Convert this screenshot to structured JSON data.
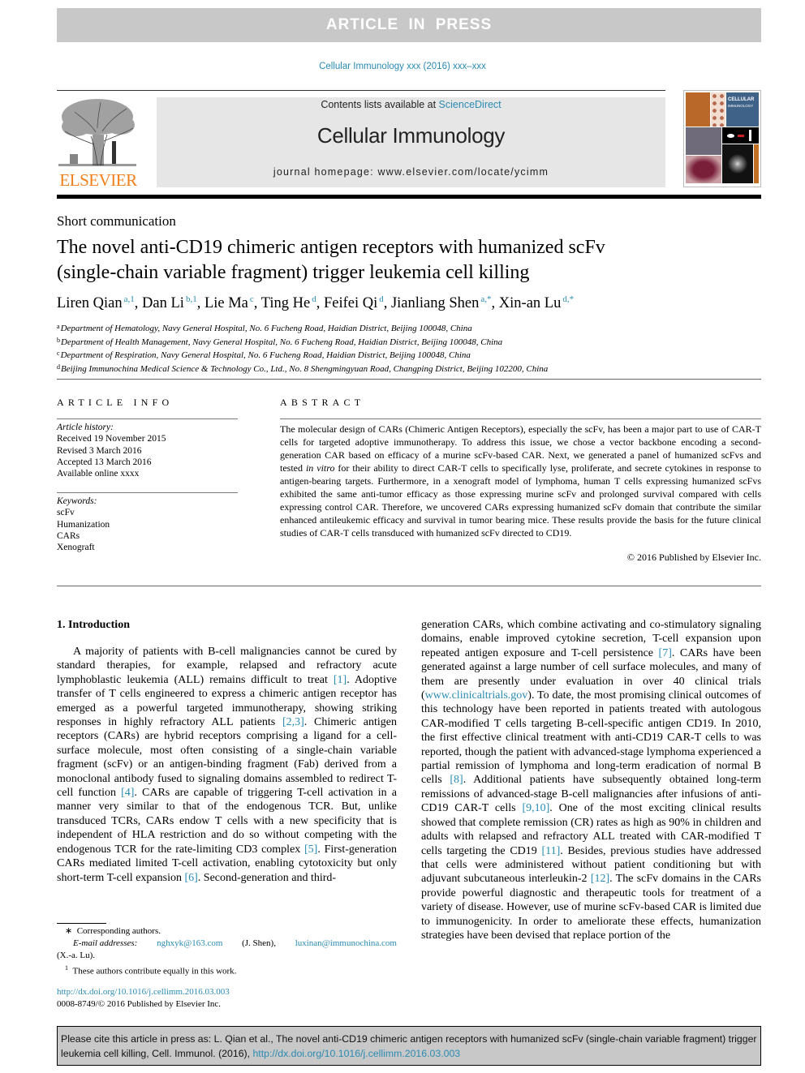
{
  "banner": {
    "text": "ARTICLE IN PRESS"
  },
  "journal_ref": "Cellular Immunology xxx (2016) xxx–xxx",
  "masthead": {
    "publisher_logo_text": "ELSEVIER",
    "contents_prefix": "Contents lists available at ",
    "contents_link": "ScienceDirect",
    "journal_title": "Cellular Immunology",
    "homepage_prefix": "journal homepage: ",
    "homepage_url": "www.elsevier.com/locate/ycimm",
    "cover_title_line1": "CELLULAR",
    "cover_title_line2": "IMMUNOLOGY"
  },
  "colors": {
    "link": "#2a8bb3",
    "elsevier_orange": "#f07f1b",
    "banner_gray": "#c8c8c8",
    "masthead_gray": "#e6e6e6"
  },
  "article": {
    "type": "Short communication",
    "title_line1": "The novel anti-CD19 chimeric antigen receptors with humanized scFv",
    "title_line2": "(single-chain variable fragment) trigger leukemia cell killing",
    "authors": [
      {
        "name": "Liren Qian",
        "sup": "a,1",
        "sep": ", "
      },
      {
        "name": "Dan Li",
        "sup": "b,1",
        "sep": ", "
      },
      {
        "name": "Lie Ma",
        "sup": "c",
        "sep": ", "
      },
      {
        "name": "Ting He",
        "sup": "d",
        "sep": ", "
      },
      {
        "name": "Feifei Qi",
        "sup": "d",
        "sep": ", "
      },
      {
        "name": "Jianliang Shen",
        "sup": "a,*",
        "sep": ", "
      },
      {
        "name": "Xin-an Lu",
        "sup": "d,*",
        "sep": ""
      }
    ],
    "affiliations": [
      {
        "key": "a",
        "text": "Department of Hematology, Navy General Hospital, No. 6 Fucheng Road, Haidian District, Beijing 100048, China"
      },
      {
        "key": "b",
        "text": "Department of Health Management, Navy General Hospital, No. 6 Fucheng Road, Haidian District, Beijing 100048, China"
      },
      {
        "key": "c",
        "text": "Department of Respiration, Navy General Hospital, No. 6 Fucheng Road, Haidian District, Beijing 100048, China"
      },
      {
        "key": "d",
        "text": "Beijing Immunochina Medical Science & Technology Co., Ltd., No. 8 Shengmingyuan Road, Changping District, Beijing 102200, China"
      }
    ]
  },
  "article_info": {
    "heading": "ARTICLE INFO",
    "history_label": "Article history:",
    "history": [
      "Received 19 November 2015",
      "Revised 3 March 2016",
      "Accepted 13 March 2016",
      "Available online xxxx"
    ],
    "keywords_label": "Keywords:",
    "keywords": [
      "scFv",
      "Humanization",
      "CARs",
      "Xenograft"
    ]
  },
  "abstract": {
    "heading": "ABSTRACT",
    "part1": "The molecular design of CARs (Chimeric Antigen Receptors), especially the scFv, has been a major part to use of CAR-T cells for targeted adoptive immunotherapy. To address this issue, we chose a vector backbone encoding a second-generation CAR based on efficacy of a murine scFv-based CAR. Next, we generated a panel of humanized scFvs and tested ",
    "italic": "in vitro",
    "part2": " for their ability to direct CAR-T cells to specifically lyse, proliferate, and secrete cytokines in response to antigen-bearing targets. Furthermore, in a xenograft model of lymphoma, human T cells expressing humanized scFvs exhibited the same anti-tumor efficacy as those expressing murine scFv and prolonged survival compared with cells expressing control CAR. Therefore, we uncovered CARs expressing humanized scFv domain that contribute the similar enhanced antileukemic efficacy and survival in tumor bearing mice. These results provide the basis for the future clinical studies of CAR-T cells transduced with humanized scFv directed to CD19.",
    "copyright": "© 2016 Published by Elsevier Inc."
  },
  "introduction": {
    "heading": "1. Introduction",
    "left_segments": [
      {
        "t": "A majority of patients with B-cell malignancies cannot be cured by standard therapies, for example, relapsed and refractory acute lymphoblastic leukemia (ALL) remains difficult to treat "
      },
      {
        "ref": "[1]"
      },
      {
        "t": ". Adoptive transfer of T cells engineered to express a chimeric antigen receptor has emerged as a powerful targeted immunotherapy, showing striking responses in highly refractory ALL patients "
      },
      {
        "ref": "[2,3]"
      },
      {
        "t": ". Chimeric antigen receptors (CARs) are hybrid receptors comprising a ligand for a cell-surface molecule, most often consisting of a single-chain variable fragment (scFv) or an antigen-binding fragment (Fab) derived from a monoclonal antibody fused to signaling domains assembled to redirect T-cell function "
      },
      {
        "ref": "[4]"
      },
      {
        "t": ". CARs are capable of triggering T-cell activation in a manner very similar to that of the endogenous TCR. But, unlike transduced TCRs, CARs endow T cells with a new specificity that is independent of HLA restriction and do so without competing with the endogenous TCR for the rate-limiting CD3 complex "
      },
      {
        "ref": "[5]"
      },
      {
        "t": ". First-generation CARs mediated limited T-cell activation, enabling cytotoxicity but only short-term T-cell expansion "
      },
      {
        "ref": "[6]"
      },
      {
        "t": ". Second-generation and third-"
      }
    ],
    "right_segments": [
      {
        "t": "generation CARs, which combine activating and co-stimulatory signaling domains, enable improved cytokine secretion, T-cell expansion upon repeated antigen exposure and T-cell persistence "
      },
      {
        "ref": "[7]"
      },
      {
        "t": ". CARs have been generated against a large number of cell surface molecules, and many of them are presently under evaluation in over 40 clinical trials ("
      },
      {
        "ref": "www.clinicaltrials.gov"
      },
      {
        "t": "). To date, the most promising clinical outcomes of this technology have been reported in patients treated with autologous CAR-modified T cells targeting B-cell-specific antigen CD19. In 2010, the first effective clinical treatment with anti-CD19 CAR-T cells to was reported, though the patient with advanced-stage lymphoma experienced a partial remission of lymphoma and long-term eradication of normal B cells "
      },
      {
        "ref": "[8]"
      },
      {
        "t": ". Additional patients have subsequently obtained long-term remissions of advanced-stage B-cell malignancies after infusions of anti-CD19 CAR-T cells "
      },
      {
        "ref": "[9,10]"
      },
      {
        "t": ". One of the most exciting clinical results showed that complete remission (CR) rates as high as 90% in children and adults with relapsed and refractory ALL treated with CAR-modified T cells targeting the CD19 "
      },
      {
        "ref": "[11]"
      },
      {
        "t": ". Besides, previous studies have addressed that cells were administered without patient conditioning but with adjuvant subcutaneous interleukin-2 "
      },
      {
        "ref": "[12]"
      },
      {
        "t": ". The scFv domains in the CARs provide powerful diagnostic and therapeutic tools for treatment of a variety of disease. However, use of murine scFv-based CAR is limited due to immunogenicity. In order to ameliorate these effects, humanization strategies have been devised that replace portion of the"
      }
    ]
  },
  "footnotes": {
    "corresponding": "Corresponding authors.",
    "email_label": "E-mail addresses:",
    "email1": "nghxyk@163.com",
    "email1_who": "(J. Shen),",
    "email2": "luxinan@immunochina.com",
    "email2_who": "(X.-a. Lu).",
    "equal_contrib_mark": "1",
    "equal_contrib": "These authors contribute equally in this work."
  },
  "doi": {
    "url": "http://dx.doi.org/10.1016/j.cellimm.2016.03.003",
    "issn_line": "0008-8749/© 2016 Published by Elsevier Inc."
  },
  "citation_box": {
    "text": "Please cite this article in press as: L. Qian et al., The novel anti-CD19 chimeric antigen receptors with humanized scFv (single-chain variable fragment) trigger leukemia cell killing, Cell. Immunol. (2016), ",
    "url": "http://dx.doi.org/10.1016/j.cellimm.2016.03.003"
  }
}
